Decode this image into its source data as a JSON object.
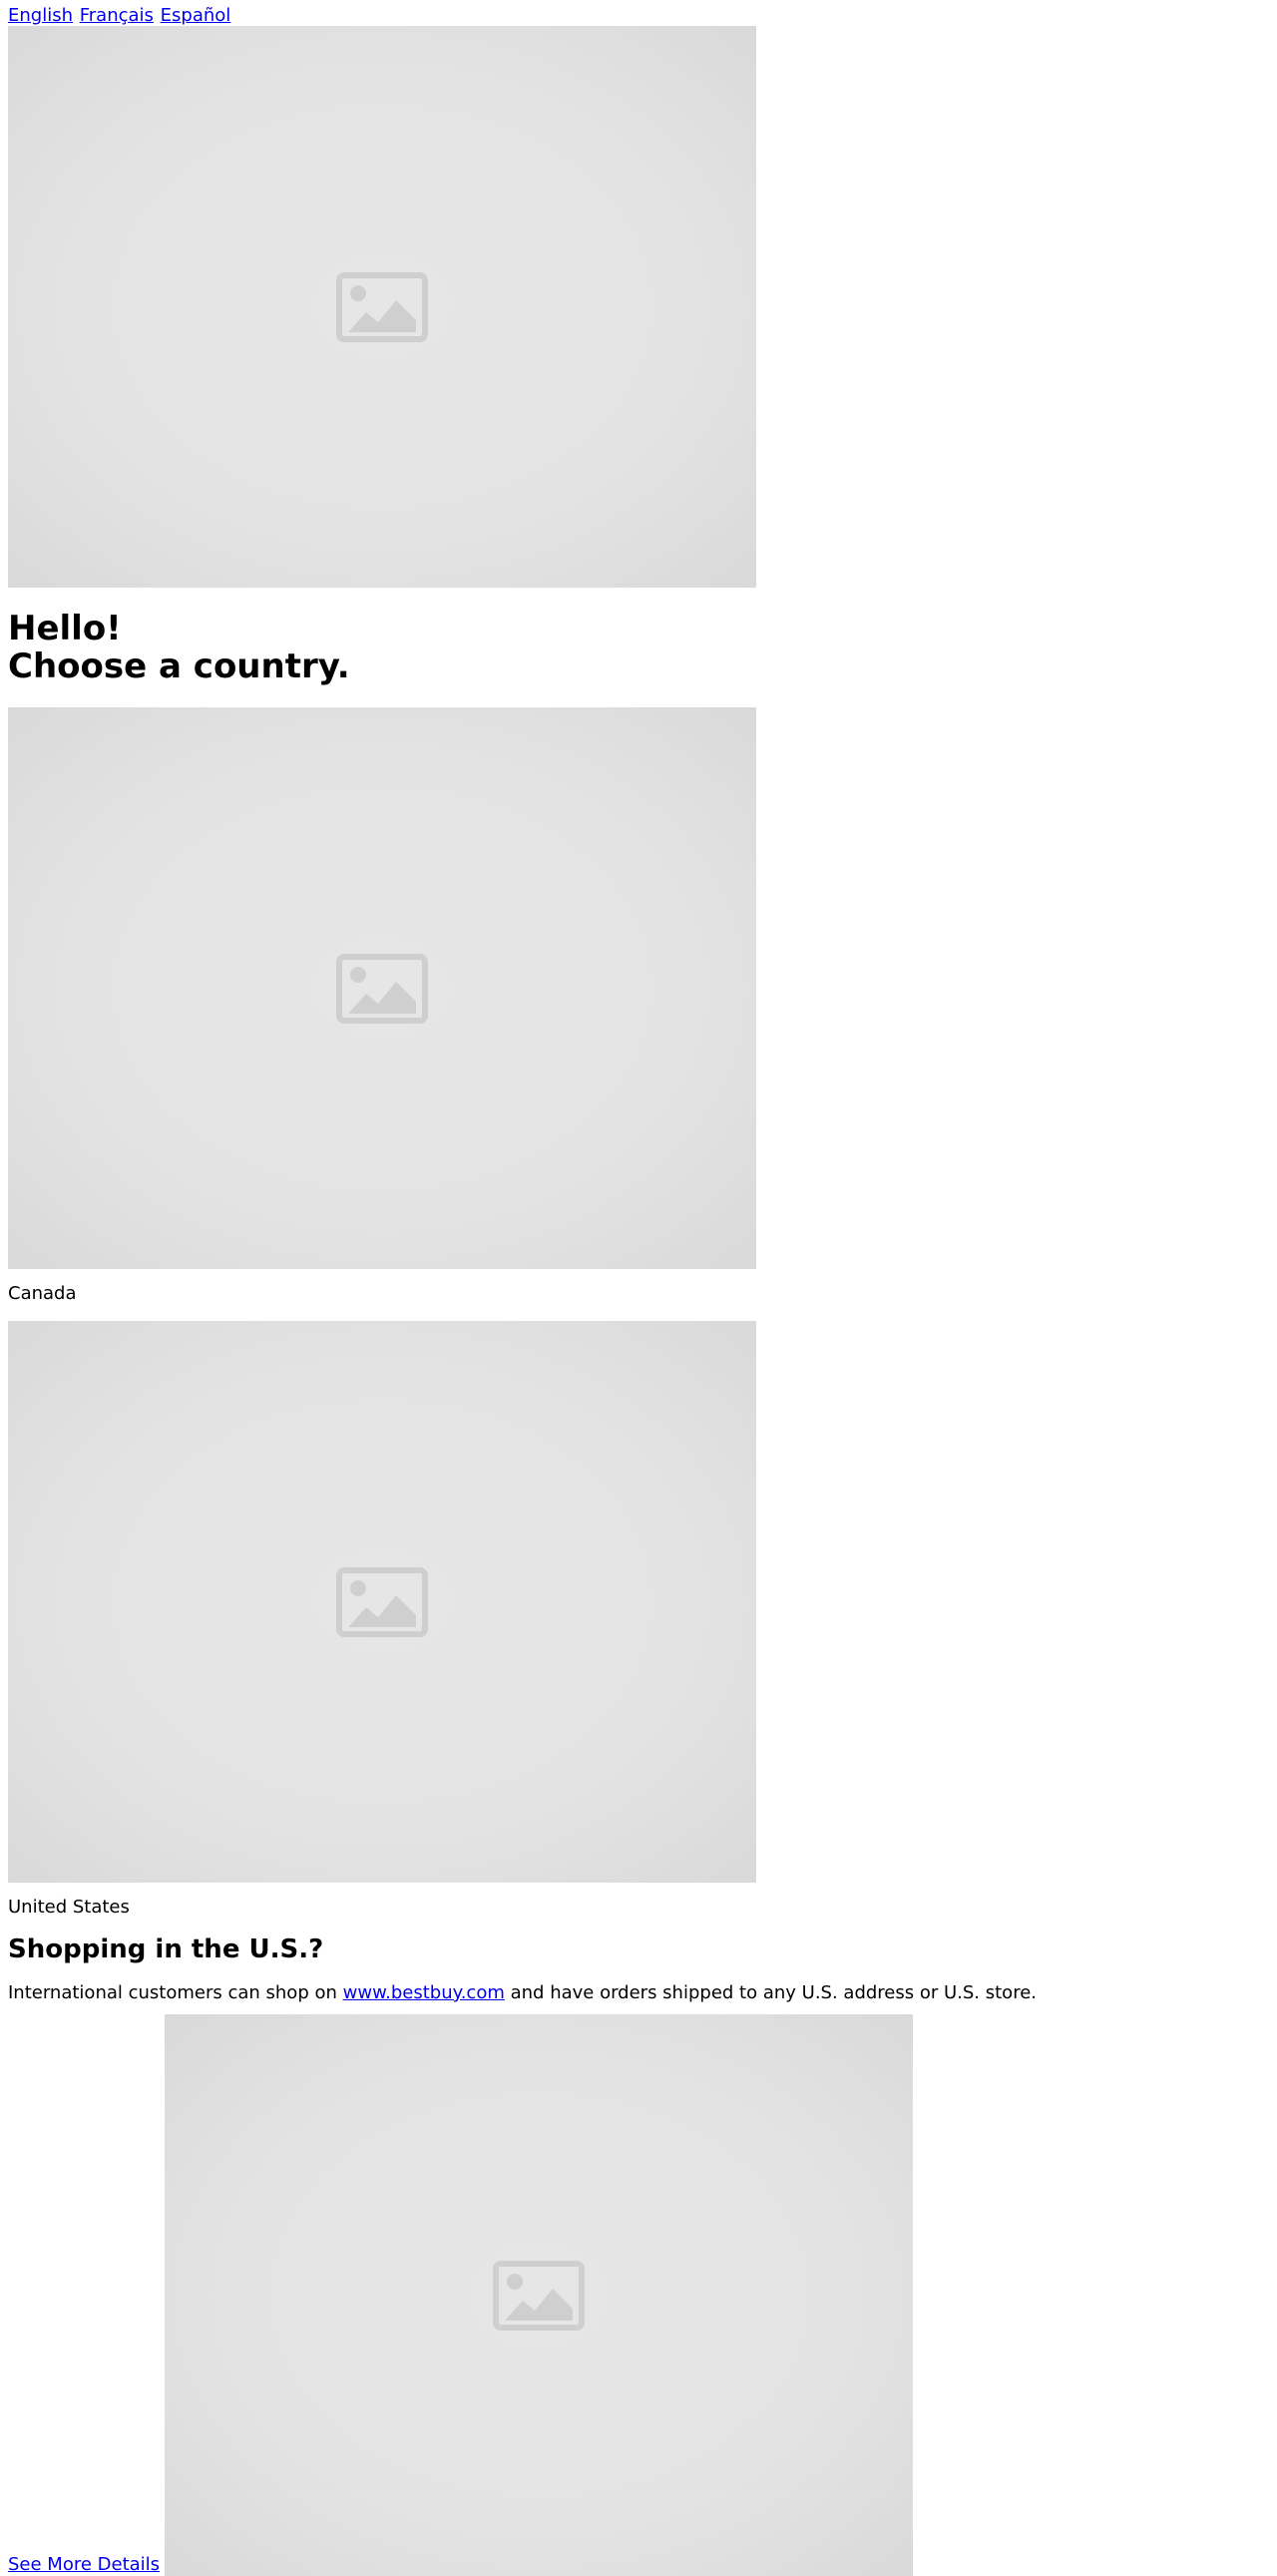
{
  "language_bar": {
    "links": [
      "English",
      "Français",
      "Español"
    ]
  },
  "hero": {
    "image_icon": "image-placeholder-icon",
    "heading_line1": "Hello!",
    "heading_line2": "Choose a country."
  },
  "countries": [
    {
      "label": "Canada",
      "image_icon": "image-placeholder-icon"
    },
    {
      "label": "United States",
      "image_icon": "image-placeholder-icon"
    }
  ],
  "us_shopping": {
    "heading": "Shopping in the U.S.?",
    "text_before": "International customers can shop on ",
    "link_text": "www.bestbuy.com",
    "text_after": " and have orders shipped to any U.S. address or U.S. store.",
    "details_link": "See More Details",
    "image_icon": "image-placeholder-icon"
  },
  "colors": {
    "link": "#0000ee",
    "placeholder_bg": "#e3e3e3",
    "placeholder_icon": "#cfcfcf"
  }
}
